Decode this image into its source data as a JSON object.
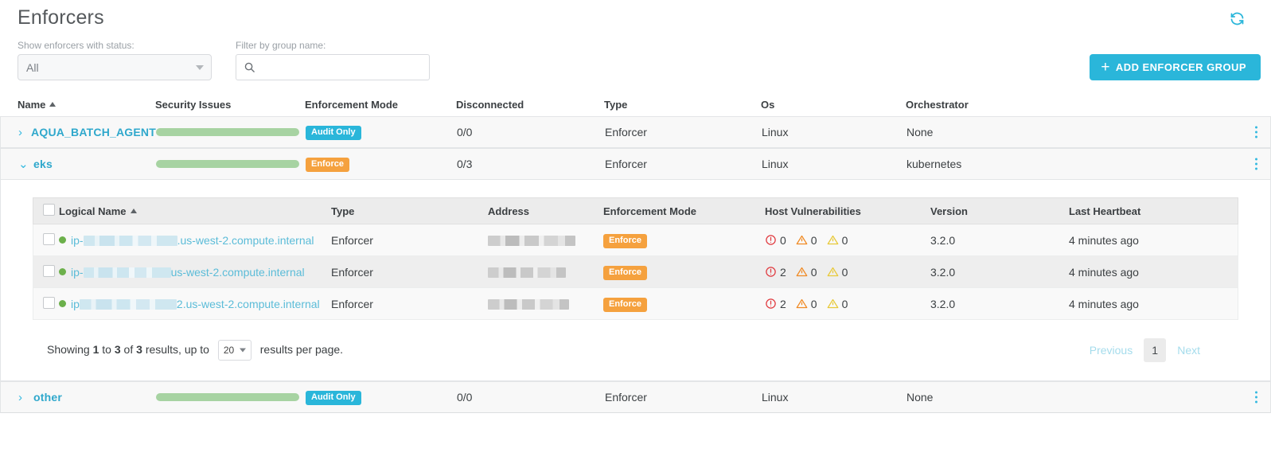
{
  "header": {
    "title": "Enforcers",
    "refresh_icon": "refresh-icon"
  },
  "filters": {
    "status_label": "Show enforcers with status:",
    "status_value": "All",
    "group_label": "Filter by group name:",
    "group_value": "",
    "group_placeholder": "",
    "search_icon": "search-icon"
  },
  "actions": {
    "add_group_label": "ADD ENFORCER GROUP",
    "add_group_plus": "+"
  },
  "table": {
    "columns": [
      "Name",
      "Security Issues",
      "Enforcement Mode",
      "Disconnected",
      "Type",
      "Os",
      "Orchestrator"
    ],
    "rows": [
      {
        "expanded": false,
        "chevron": "›",
        "name": "AQUA_BATCH_AGENT",
        "security_issues_pct": 100,
        "mode": "Audit Only",
        "mode_kind": "audit",
        "disconnected": "0/0",
        "type": "Enforcer",
        "os": "Linux",
        "orchestrator": "None"
      },
      {
        "expanded": true,
        "chevron": "⌄",
        "name": "eks",
        "security_issues_pct": 100,
        "mode": "Enforce",
        "mode_kind": "enforce",
        "disconnected": "0/3",
        "type": "Enforcer",
        "os": "Linux",
        "orchestrator": "kubernetes"
      },
      {
        "expanded": false,
        "chevron": "›",
        "name": "other",
        "security_issues_pct": 100,
        "mode": "Audit Only",
        "mode_kind": "audit",
        "disconnected": "0/0",
        "type": "Enforcer",
        "os": "Linux",
        "orchestrator": "None"
      }
    ]
  },
  "inner_table": {
    "columns": [
      "Logical Name",
      "Type",
      "Address",
      "Enforcement Mode",
      "Host Vulnerabilities",
      "Version",
      "Last Heartbeat"
    ],
    "rows": [
      {
        "status": "online",
        "name_prefix": "ip-",
        "name_redacted_width": 118,
        "name_suffix": ".us-west-2.compute.internal",
        "type": "Enforcer",
        "address_redacted_width": 110,
        "mode": "Enforce",
        "mode_kind": "enforce",
        "vuln_critical": "0",
        "vuln_high": "0",
        "vuln_medium": "0",
        "version": "3.2.0",
        "last_heartbeat": "4 minutes ago"
      },
      {
        "status": "online",
        "name_prefix": "ip-",
        "name_redacted_width": 110,
        "name_suffix": "us-west-2.compute.internal",
        "type": "Enforcer",
        "address_redacted_width": 98,
        "mode": "Enforce",
        "mode_kind": "enforce",
        "vuln_critical": "2",
        "vuln_high": "0",
        "vuln_medium": "0",
        "version": "3.2.0",
        "last_heartbeat": "4 minutes ago"
      },
      {
        "status": "online",
        "name_prefix": "ip",
        "name_redacted_width": 122,
        "name_suffix": "2.us-west-2.compute.internal",
        "type": "Enforcer",
        "address_redacted_width": 102,
        "mode": "Enforce",
        "mode_kind": "enforce",
        "vuln_critical": "2",
        "vuln_high": "0",
        "vuln_medium": "0",
        "version": "3.2.0",
        "last_heartbeat": "4 minutes ago"
      }
    ]
  },
  "pagination": {
    "showing_prefix": "Showing",
    "from": "1",
    "to_word": "to",
    "to": "3",
    "of_word": "of",
    "total": "3",
    "results_word": "results, up to",
    "per_page": "20",
    "per_page_suffix": "results per page.",
    "previous": "Previous",
    "current_page": "1",
    "next": "Next"
  },
  "colors": {
    "accent": "#2ab6da",
    "enforce_badge": "#f5a13e",
    "audit_badge": "#2ab6da",
    "progress_green": "#a7d3a2",
    "status_online": "#6cb04b",
    "vuln_critical": "#e0393e",
    "vuln_high": "#f08a24",
    "vuln_medium": "#e8c939"
  }
}
